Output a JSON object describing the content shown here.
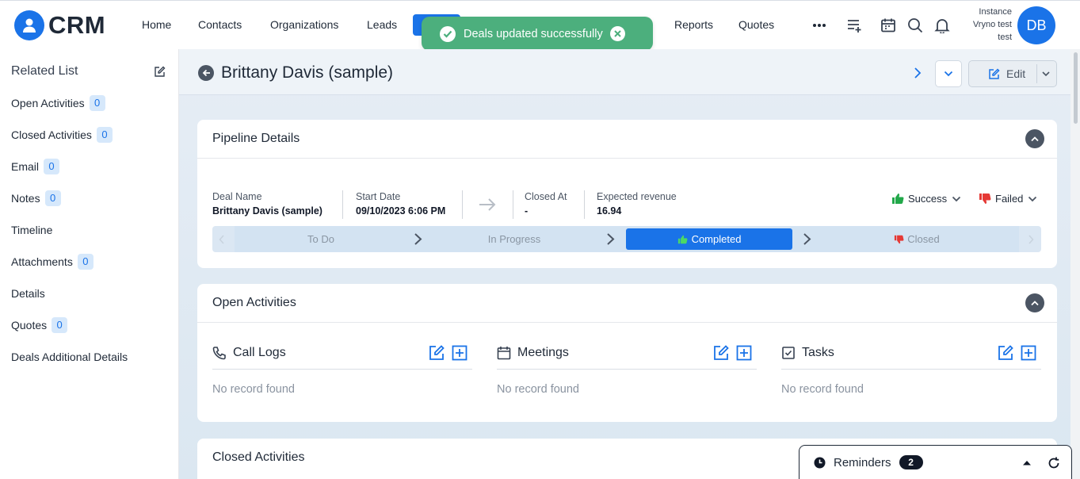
{
  "app": {
    "logo_text": "CRM"
  },
  "nav": {
    "items": [
      "Home",
      "Contacts",
      "Organizations",
      "Leads",
      "Reports",
      "Quotes"
    ],
    "more_icon": "ellipsis-icon",
    "icons": [
      "add-list-icon",
      "calendar-icon",
      "search-icon",
      "bell-icon"
    ]
  },
  "user": {
    "line1": "Instance",
    "line2": "Vryno test",
    "line3": "test",
    "initials": "DB"
  },
  "toast": {
    "message": "Deals updated successfully",
    "color": "#4caf7d"
  },
  "sidebar": {
    "title": "Related List",
    "items": [
      {
        "label": "Open Activities",
        "count": "0"
      },
      {
        "label": "Closed Activities",
        "count": "0"
      },
      {
        "label": "Email",
        "count": "0"
      },
      {
        "label": "Notes",
        "count": "0"
      },
      {
        "label": "Timeline"
      },
      {
        "label": "Attachments",
        "count": "0"
      },
      {
        "label": "Details"
      },
      {
        "label": "Quotes",
        "count": "0"
      },
      {
        "label": "Deals Additional Details"
      }
    ]
  },
  "record": {
    "title": "Brittany Davis (sample)",
    "edit_label": "Edit"
  },
  "pipeline": {
    "title": "Pipeline Details",
    "deal_name_label": "Deal Name",
    "deal_name": "Brittany Davis (sample)",
    "start_date_label": "Start Date",
    "start_date": "09/10/2023 6:06 PM",
    "closed_at_label": "Closed At",
    "closed_at": "-",
    "expected_revenue_label": "Expected revenue",
    "expected_revenue": "16.94",
    "success_label": "Success",
    "failed_label": "Failed",
    "stages": [
      "To Do",
      "In Progress",
      "Completed",
      "Closed"
    ],
    "active_stage": "Completed"
  },
  "open_activities": {
    "title": "Open Activities",
    "columns": [
      {
        "title": "Call Logs",
        "empty": "No record found"
      },
      {
        "title": "Meetings",
        "empty": "No record found"
      },
      {
        "title": "Tasks",
        "empty": "No record found"
      }
    ]
  },
  "closed_activities": {
    "title": "Closed Activities"
  },
  "reminders": {
    "label": "Reminders",
    "count": "2"
  },
  "colors": {
    "accent": "#1a73e8",
    "success": "#22a84a",
    "failed": "#e53935"
  }
}
